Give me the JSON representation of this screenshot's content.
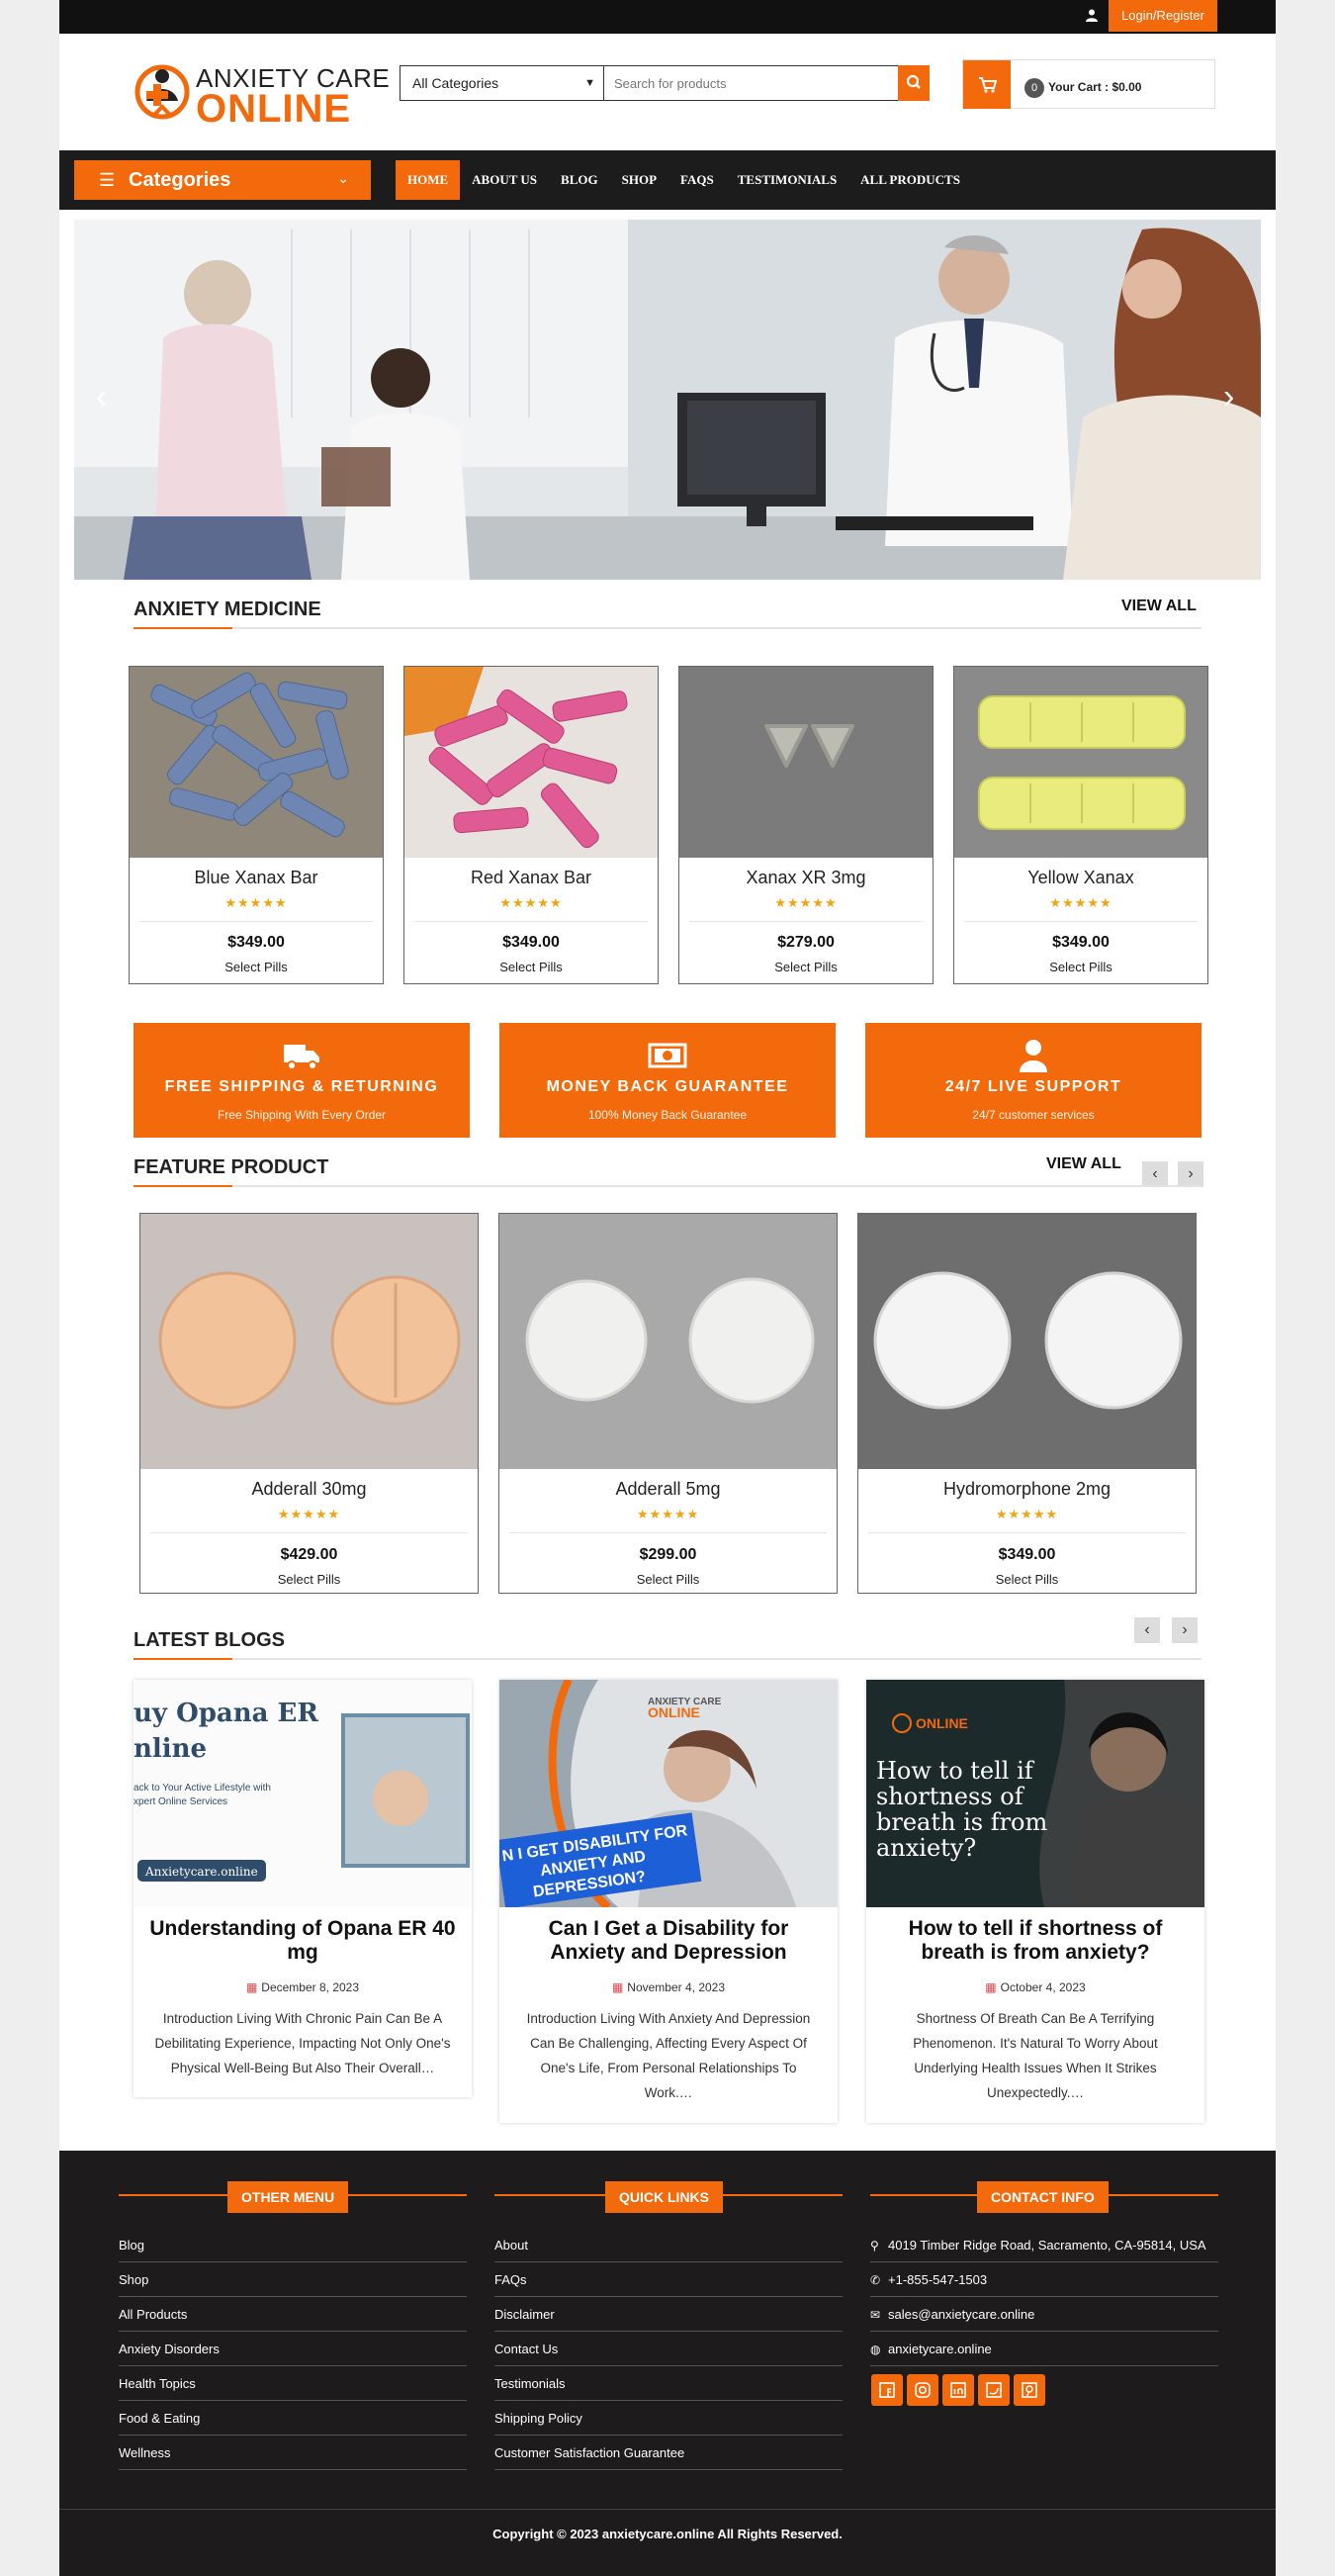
{
  "topbar": {
    "login_label": "Login/Register",
    "user_icon": "user-icon"
  },
  "header": {
    "logo_line1": "ANXIETY CARE",
    "logo_line2": "ONLINE",
    "category_select": "All Categories",
    "search_placeholder": "Search for products",
    "cart_count": "0",
    "cart_label": "Your Cart : $0.00"
  },
  "nav": {
    "categories_label": "Categories",
    "items": [
      "HOME",
      "ABOUT US",
      "BLOG",
      "SHOP",
      "FAQS",
      "TESTIMONIALS",
      "ALL PRODUCTS"
    ],
    "active": "HOME"
  },
  "hero": {
    "prev": "‹",
    "next": "›"
  },
  "anxiety_medicine": {
    "title": "ANXIETY MEDICINE",
    "view_all": "VIEW ALL",
    "products": [
      {
        "name": "Blue Xanax Bar",
        "price": "$349.00",
        "action": "Select Pills",
        "rating": 5
      },
      {
        "name": "Red Xanax Bar",
        "price": "$349.00",
        "action": "Select Pills",
        "rating": 5
      },
      {
        "name": "Xanax XR 3mg",
        "price": "$279.00",
        "action": "Select Pills",
        "rating": 5
      },
      {
        "name": "Yellow Xanax",
        "price": "$349.00",
        "action": "Select Pills",
        "rating": 5
      }
    ]
  },
  "features": [
    {
      "title": "FREE SHIPPING & RETURNING",
      "subtitle": "Free Shipping With Every Order",
      "icon": "truck-icon"
    },
    {
      "title": "MONEY BACK GUARANTEE",
      "subtitle": "100% Money Back Guarantee",
      "icon": "money-icon"
    },
    {
      "title": "24/7 LIVE SUPPORT",
      "subtitle": "24/7 customer services",
      "icon": "user-icon"
    }
  ],
  "feature_product": {
    "title": "FEATURE PRODUCT",
    "view_all": "VIEW ALL",
    "prev": "‹",
    "next": "›",
    "products": [
      {
        "name": "Adderall 30mg",
        "price": "$429.00",
        "action": "Select Pills",
        "rating": 5
      },
      {
        "name": "Adderall 5mg",
        "price": "$299.00",
        "action": "Select Pills",
        "rating": 5
      },
      {
        "name": "Hydromorphone 2mg",
        "price": "$349.00",
        "action": "Select Pills",
        "rating": 5
      }
    ]
  },
  "blogs": {
    "title": "LATEST BLOGS",
    "prev": "‹",
    "next": "›",
    "posts": [
      {
        "title": "Understanding of Opana ER 40 mg",
        "date": "December 8, 2023",
        "excerpt": "Introduction Living With Chronic Pain Can Be A Debilitating Experience, Impacting Not Only One's Physical Well-Being But Also Their Overall…",
        "image_text": [
          "uy Opana ER",
          "nline",
          "ack to Your Active Lifestyle with",
          "xpert Online Services",
          "Anxietycare.online"
        ]
      },
      {
        "title": "Can I Get a Disability for Anxiety and Depression",
        "date": "November 4, 2023",
        "excerpt": "Introduction Living With Anxiety And Depression Can Be Challenging, Affecting Every Aspect Of One's Life, From Personal Relationships To Work.…",
        "image_text": [
          "N I GET DISABILITY FOR",
          "ANXIETY AND",
          "DEPRESSION?",
          "ANXIETY CARE",
          "ONLINE"
        ]
      },
      {
        "title": "How to tell if shortness of breath is from anxiety?",
        "date": "October 4, 2023",
        "excerpt": "Shortness Of Breath Can Be A Terrifying Phenomenon. It's Natural To Worry About Underlying Health Issues When It Strikes Unexpectedly.…",
        "image_text": [
          "ONLINE",
          "How to tell if",
          "shortness of",
          "breath is from",
          "anxiety?"
        ]
      }
    ]
  },
  "footer": {
    "other_menu": {
      "title": "OTHER MENU",
      "links": [
        "Blog",
        "Shop",
        "All Products",
        "Anxiety Disorders",
        "Health Topics",
        "Food & Eating",
        "Wellness"
      ]
    },
    "quick_links": {
      "title": "QUICK LINKS",
      "links": [
        "About",
        "FAQs",
        "Disclaimer",
        "Contact Us",
        "Testimonials",
        "Shipping Policy",
        "Customer Satisfaction Guarantee"
      ]
    },
    "contact": {
      "title": "CONTACT INFO",
      "items": [
        {
          "icon": "map-pin-icon",
          "text": "4019 Timber Ridge Road, Sacramento, CA-95814, USA"
        },
        {
          "icon": "phone-icon",
          "text": "+1-855-547-1503"
        },
        {
          "icon": "mail-icon",
          "text": "sales@anxietycare.online"
        },
        {
          "icon": "globe-icon",
          "text": "anxietycare.online"
        }
      ]
    },
    "social": [
      "facebook-icon",
      "instagram-icon",
      "linkedin-icon",
      "twitter-icon",
      "pinterest-icon"
    ],
    "copyright": "Copyright © 2023 anxietycare.online All Rights Reserved."
  },
  "colors": {
    "accent": "#f26a0c",
    "dark": "#1c1c1c",
    "star": "#f2a40c"
  }
}
